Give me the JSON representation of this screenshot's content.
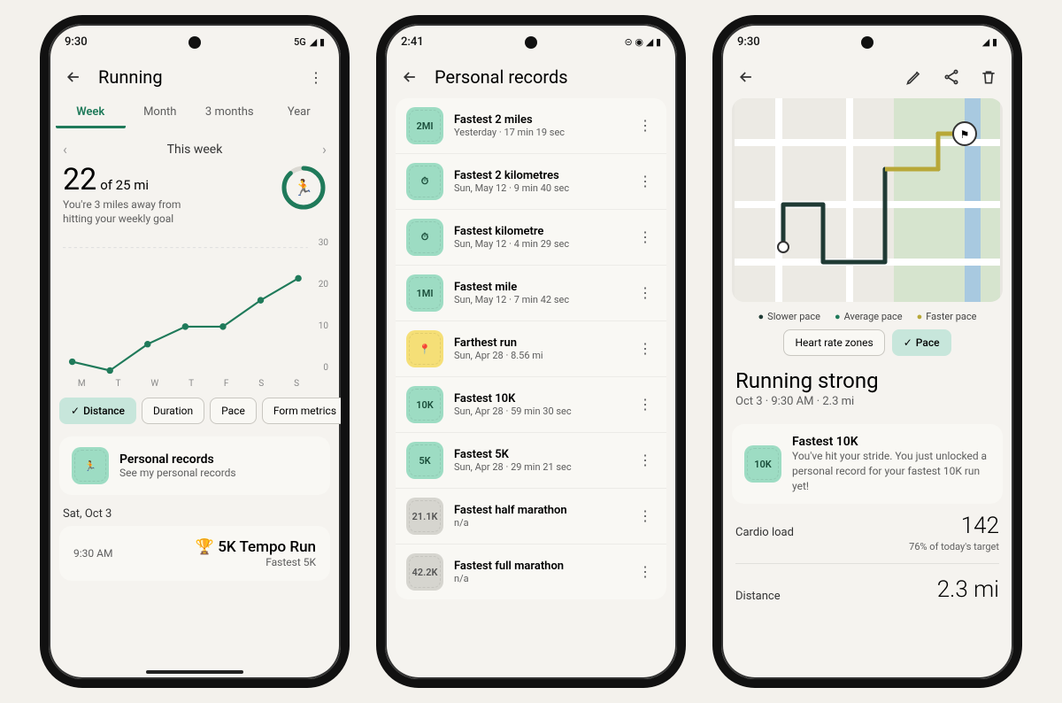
{
  "screen1": {
    "status_time": "9:30",
    "status_net": "5G",
    "title": "Running",
    "tabs": [
      "Week",
      "Month",
      "3 months",
      "Year"
    ],
    "active_tab": 0,
    "period_label": "This week",
    "progress_value": "22",
    "progress_of": "of 25 mi",
    "goal_hint": "You're 3 miles away from hitting your weekly goal",
    "chips": [
      "Distance",
      "Duration",
      "Pace",
      "Form metrics"
    ],
    "selected_chip": 0,
    "pr_title": "Personal records",
    "pr_sub": "See my personal records",
    "date_header": "Sat, Oct 3",
    "activity_time": "9:30 AM",
    "activity_title": "5K Tempo Run",
    "activity_sub": "Fastest 5K"
  },
  "chart_data": {
    "type": "line",
    "categories": [
      "M",
      "T",
      "W",
      "T",
      "F",
      "S",
      "S"
    ],
    "values": [
      4,
      2,
      8,
      12,
      12,
      18,
      23
    ],
    "ylim": [
      0,
      30
    ],
    "yticks": [
      0,
      10,
      20,
      30
    ]
  },
  "screen2": {
    "status_time": "2:41",
    "title": "Personal records",
    "records": [
      {
        "badge": "2MI",
        "color": "green",
        "title": "Fastest 2 miles",
        "sub": "Yesterday · 17 min 19 sec"
      },
      {
        "badge": "⏱",
        "color": "green",
        "title": "Fastest 2 kilometres",
        "sub": "Sun, May 12 · 9 min 40 sec"
      },
      {
        "badge": "⏱",
        "color": "green",
        "title": "Fastest kilometre",
        "sub": "Sun, May 12 · 4 min 29 sec"
      },
      {
        "badge": "1MI",
        "color": "green",
        "title": "Fastest mile",
        "sub": "Sun, May 12 · 7 min 42 sec"
      },
      {
        "badge": "📍",
        "color": "yellow",
        "title": "Farthest run",
        "sub": "Sun, Apr 28 · 8.56 mi"
      },
      {
        "badge": "10K",
        "color": "green",
        "title": "Fastest 10K",
        "sub": "Sun, Apr 28 · 59 min 30 sec"
      },
      {
        "badge": "5K",
        "color": "green",
        "title": "Fastest 5K",
        "sub": "Sun, Apr 28 · 29 min 21 sec"
      },
      {
        "badge": "21.1K",
        "color": "grey",
        "title": "Fastest half marathon",
        "sub": "n/a"
      },
      {
        "badge": "42.2K",
        "color": "grey",
        "title": "Fastest full marathon",
        "sub": "n/a"
      }
    ]
  },
  "screen3": {
    "status_time": "9:30",
    "legend": {
      "slow": "Slower pace",
      "avg": "Average pace",
      "fast": "Faster pace"
    },
    "toggle_hr": "Heart rate zones",
    "toggle_pace": "Pace",
    "big_title": "Running strong",
    "detail_sub": "Oct 3 · 9:30 AM  ·  2.3 mi",
    "pr_badge": "10K",
    "pr_title": "Fastest 10K",
    "pr_body": "You've hit your stride. You just unlocked a personal record for your fastest 10K run yet!",
    "cardio_label": "Cardio load",
    "cardio_value": "142",
    "cardio_sub": "76% of today's target",
    "distance_label": "Distance",
    "distance_value": "2.3 mi"
  }
}
